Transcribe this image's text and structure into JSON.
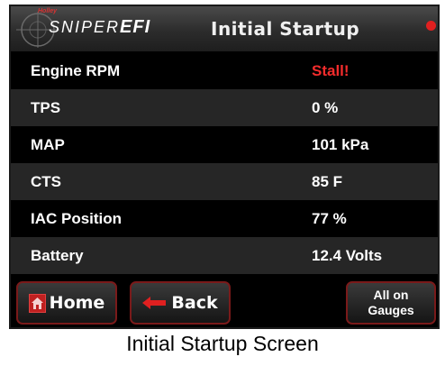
{
  "header": {
    "brand_small": "Holley",
    "brand_name": "SNIPER",
    "brand_suffix": "EFI",
    "screen_title": "Initial Startup",
    "status_color": "#e02020"
  },
  "rows": [
    {
      "label": "Engine RPM",
      "value": "Stall!",
      "value_color": "#f22c2c"
    },
    {
      "label": "TPS",
      "value": "0 %"
    },
    {
      "label": "MAP",
      "value": "101 kPa"
    },
    {
      "label": "CTS",
      "value": "85 F"
    },
    {
      "label": "IAC Position",
      "value": "77 %"
    },
    {
      "label": "Battery",
      "value": "12.4 Volts"
    }
  ],
  "buttons": {
    "home_label": "Home",
    "home_icon": "home-icon",
    "back_label": "Back",
    "back_icon": "left-arrow-icon",
    "gauges_line1": "All on",
    "gauges_line2": "Gauges"
  },
  "caption": "Initial Startup Screen",
  "colors": {
    "accent_border": "#7a1a1a",
    "alert": "#f22c2c"
  }
}
